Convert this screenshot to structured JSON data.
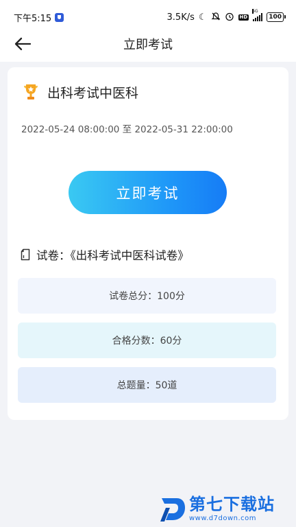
{
  "status_bar": {
    "time": "下午5:15",
    "net_speed": "3.5K/s",
    "network_type": "5G",
    "battery": "100",
    "icons": [
      "shield-icon",
      "moon-icon",
      "mute-icon",
      "alarm-icon",
      "hd-icon",
      "signal-icon",
      "battery-icon"
    ]
  },
  "header": {
    "title": "立即考试",
    "back_icon": "arrow-left-icon"
  },
  "exam": {
    "icon": "trophy-icon",
    "title": "出科考试中医科",
    "time_range": "2022-05-24 08:00:00 至 2022-05-31 22:00:00",
    "start_button": "立即考试",
    "paper_icon": "document-icon",
    "paper_label": "试卷：《出科考试中医科试卷》",
    "info": {
      "total_score": "试卷总分：100分",
      "pass_score": "合格分数：60分",
      "question_count": "总题量：50道"
    }
  },
  "watermark": {
    "title": "第七下载站",
    "url": "www.d7down.com"
  },
  "colors": {
    "accent_start": "#3ac9f2",
    "accent_end": "#167cf6",
    "trophy": "#f0a12a",
    "watermark": "#1a6fe0"
  }
}
